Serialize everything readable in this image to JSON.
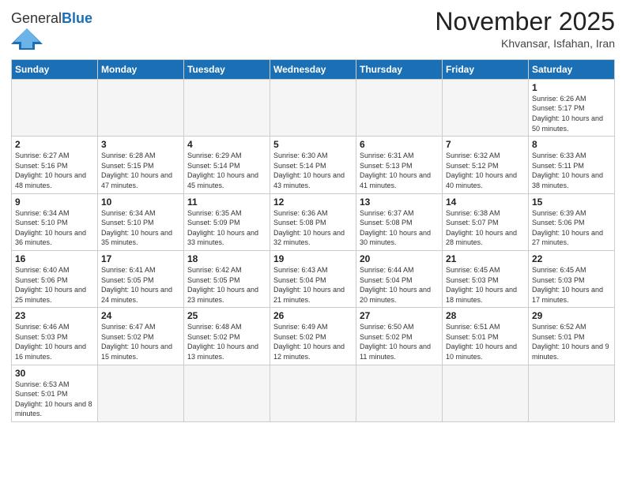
{
  "logo": {
    "text_general": "General",
    "text_blue": "Blue"
  },
  "title": "November 2025",
  "location": "Khvansar, Isfahan, Iran",
  "days_of_week": [
    "Sunday",
    "Monday",
    "Tuesday",
    "Wednesday",
    "Thursday",
    "Friday",
    "Saturday"
  ],
  "weeks": [
    [
      {
        "day": "",
        "sunrise": "",
        "sunset": "",
        "daylight": ""
      },
      {
        "day": "",
        "sunrise": "",
        "sunset": "",
        "daylight": ""
      },
      {
        "day": "",
        "sunrise": "",
        "sunset": "",
        "daylight": ""
      },
      {
        "day": "",
        "sunrise": "",
        "sunset": "",
        "daylight": ""
      },
      {
        "day": "",
        "sunrise": "",
        "sunset": "",
        "daylight": ""
      },
      {
        "day": "",
        "sunrise": "",
        "sunset": "",
        "daylight": ""
      },
      {
        "day": "1",
        "sunrise": "Sunrise: 6:26 AM",
        "sunset": "Sunset: 5:17 PM",
        "daylight": "Daylight: 10 hours and 50 minutes."
      }
    ],
    [
      {
        "day": "2",
        "sunrise": "Sunrise: 6:27 AM",
        "sunset": "Sunset: 5:16 PM",
        "daylight": "Daylight: 10 hours and 48 minutes."
      },
      {
        "day": "3",
        "sunrise": "Sunrise: 6:28 AM",
        "sunset": "Sunset: 5:15 PM",
        "daylight": "Daylight: 10 hours and 47 minutes."
      },
      {
        "day": "4",
        "sunrise": "Sunrise: 6:29 AM",
        "sunset": "Sunset: 5:14 PM",
        "daylight": "Daylight: 10 hours and 45 minutes."
      },
      {
        "day": "5",
        "sunrise": "Sunrise: 6:30 AM",
        "sunset": "Sunset: 5:14 PM",
        "daylight": "Daylight: 10 hours and 43 minutes."
      },
      {
        "day": "6",
        "sunrise": "Sunrise: 6:31 AM",
        "sunset": "Sunset: 5:13 PM",
        "daylight": "Daylight: 10 hours and 41 minutes."
      },
      {
        "day": "7",
        "sunrise": "Sunrise: 6:32 AM",
        "sunset": "Sunset: 5:12 PM",
        "daylight": "Daylight: 10 hours and 40 minutes."
      },
      {
        "day": "8",
        "sunrise": "Sunrise: 6:33 AM",
        "sunset": "Sunset: 5:11 PM",
        "daylight": "Daylight: 10 hours and 38 minutes."
      }
    ],
    [
      {
        "day": "9",
        "sunrise": "Sunrise: 6:34 AM",
        "sunset": "Sunset: 5:10 PM",
        "daylight": "Daylight: 10 hours and 36 minutes."
      },
      {
        "day": "10",
        "sunrise": "Sunrise: 6:34 AM",
        "sunset": "Sunset: 5:10 PM",
        "daylight": "Daylight: 10 hours and 35 minutes."
      },
      {
        "day": "11",
        "sunrise": "Sunrise: 6:35 AM",
        "sunset": "Sunset: 5:09 PM",
        "daylight": "Daylight: 10 hours and 33 minutes."
      },
      {
        "day": "12",
        "sunrise": "Sunrise: 6:36 AM",
        "sunset": "Sunset: 5:08 PM",
        "daylight": "Daylight: 10 hours and 32 minutes."
      },
      {
        "day": "13",
        "sunrise": "Sunrise: 6:37 AM",
        "sunset": "Sunset: 5:08 PM",
        "daylight": "Daylight: 10 hours and 30 minutes."
      },
      {
        "day": "14",
        "sunrise": "Sunrise: 6:38 AM",
        "sunset": "Sunset: 5:07 PM",
        "daylight": "Daylight: 10 hours and 28 minutes."
      },
      {
        "day": "15",
        "sunrise": "Sunrise: 6:39 AM",
        "sunset": "Sunset: 5:06 PM",
        "daylight": "Daylight: 10 hours and 27 minutes."
      }
    ],
    [
      {
        "day": "16",
        "sunrise": "Sunrise: 6:40 AM",
        "sunset": "Sunset: 5:06 PM",
        "daylight": "Daylight: 10 hours and 25 minutes."
      },
      {
        "day": "17",
        "sunrise": "Sunrise: 6:41 AM",
        "sunset": "Sunset: 5:05 PM",
        "daylight": "Daylight: 10 hours and 24 minutes."
      },
      {
        "day": "18",
        "sunrise": "Sunrise: 6:42 AM",
        "sunset": "Sunset: 5:05 PM",
        "daylight": "Daylight: 10 hours and 23 minutes."
      },
      {
        "day": "19",
        "sunrise": "Sunrise: 6:43 AM",
        "sunset": "Sunset: 5:04 PM",
        "daylight": "Daylight: 10 hours and 21 minutes."
      },
      {
        "day": "20",
        "sunrise": "Sunrise: 6:44 AM",
        "sunset": "Sunset: 5:04 PM",
        "daylight": "Daylight: 10 hours and 20 minutes."
      },
      {
        "day": "21",
        "sunrise": "Sunrise: 6:45 AM",
        "sunset": "Sunset: 5:03 PM",
        "daylight": "Daylight: 10 hours and 18 minutes."
      },
      {
        "day": "22",
        "sunrise": "Sunrise: 6:45 AM",
        "sunset": "Sunset: 5:03 PM",
        "daylight": "Daylight: 10 hours and 17 minutes."
      }
    ],
    [
      {
        "day": "23",
        "sunrise": "Sunrise: 6:46 AM",
        "sunset": "Sunset: 5:03 PM",
        "daylight": "Daylight: 10 hours and 16 minutes."
      },
      {
        "day": "24",
        "sunrise": "Sunrise: 6:47 AM",
        "sunset": "Sunset: 5:02 PM",
        "daylight": "Daylight: 10 hours and 15 minutes."
      },
      {
        "day": "25",
        "sunrise": "Sunrise: 6:48 AM",
        "sunset": "Sunset: 5:02 PM",
        "daylight": "Daylight: 10 hours and 13 minutes."
      },
      {
        "day": "26",
        "sunrise": "Sunrise: 6:49 AM",
        "sunset": "Sunset: 5:02 PM",
        "daylight": "Daylight: 10 hours and 12 minutes."
      },
      {
        "day": "27",
        "sunrise": "Sunrise: 6:50 AM",
        "sunset": "Sunset: 5:02 PM",
        "daylight": "Daylight: 10 hours and 11 minutes."
      },
      {
        "day": "28",
        "sunrise": "Sunrise: 6:51 AM",
        "sunset": "Sunset: 5:01 PM",
        "daylight": "Daylight: 10 hours and 10 minutes."
      },
      {
        "day": "29",
        "sunrise": "Sunrise: 6:52 AM",
        "sunset": "Sunset: 5:01 PM",
        "daylight": "Daylight: 10 hours and 9 minutes."
      }
    ],
    [
      {
        "day": "30",
        "sunrise": "Sunrise: 6:53 AM",
        "sunset": "Sunset: 5:01 PM",
        "daylight": "Daylight: 10 hours and 8 minutes."
      },
      {
        "day": "",
        "sunrise": "",
        "sunset": "",
        "daylight": ""
      },
      {
        "day": "",
        "sunrise": "",
        "sunset": "",
        "daylight": ""
      },
      {
        "day": "",
        "sunrise": "",
        "sunset": "",
        "daylight": ""
      },
      {
        "day": "",
        "sunrise": "",
        "sunset": "",
        "daylight": ""
      },
      {
        "day": "",
        "sunrise": "",
        "sunset": "",
        "daylight": ""
      },
      {
        "day": "",
        "sunrise": "",
        "sunset": "",
        "daylight": ""
      }
    ]
  ]
}
